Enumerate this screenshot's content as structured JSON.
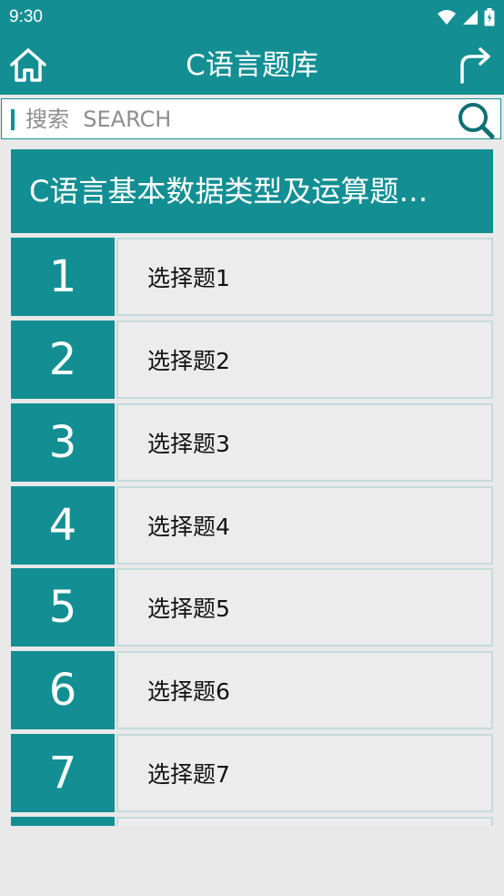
{
  "status_bar": {
    "time": "9:30",
    "icons": [
      "wifi-icon",
      "signal-icon",
      "battery-icon"
    ]
  },
  "app_bar": {
    "title": "C语言题库",
    "left_icon": "home-icon",
    "right_icon": "refresh-icon"
  },
  "search": {
    "placeholder": "搜索  SEARCH",
    "value": "",
    "icon": "search-icon"
  },
  "category": {
    "title": "C语言基本数据类型及运算题…"
  },
  "questions": [
    {
      "number": "1",
      "label": "选择题1"
    },
    {
      "number": "2",
      "label": "选择题2"
    },
    {
      "number": "3",
      "label": "选择题3"
    },
    {
      "number": "4",
      "label": "选择题4"
    },
    {
      "number": "5",
      "label": "选择题5"
    },
    {
      "number": "6",
      "label": "选择题6"
    },
    {
      "number": "7",
      "label": "选择题7"
    },
    {
      "number": "",
      "label": ""
    }
  ],
  "colors": {
    "primary": "#138f93",
    "background": "#e9e9e9",
    "row_background": "#ececec",
    "row_border": "#c4dbdb"
  }
}
